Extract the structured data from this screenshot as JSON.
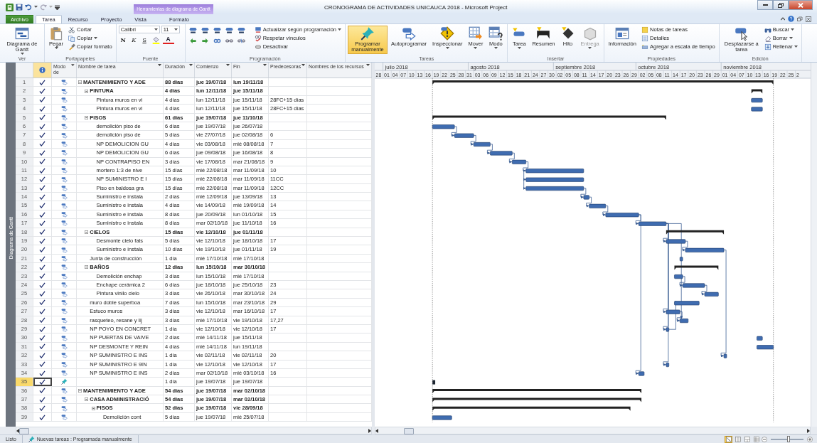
{
  "window": {
    "title": "CRONOGRAMA DE ACTIVIDADES UNICAUCA 2018  -  Microsoft Project",
    "contextual_group": "Herramientas de diagrama de Gantt"
  },
  "tabs": [
    {
      "label": "Archivo",
      "kind": "file",
      "selected": false
    },
    {
      "label": "Tarea",
      "kind": "normal",
      "selected": true
    },
    {
      "label": "Recurso",
      "kind": "normal",
      "selected": false
    },
    {
      "label": "Proyecto",
      "kind": "normal",
      "selected": false
    },
    {
      "label": "Vista",
      "kind": "normal",
      "selected": false
    },
    {
      "label": "Formato",
      "kind": "contextual",
      "selected": false
    }
  ],
  "ribbon": {
    "groups": [
      {
        "label": "Ver",
        "items": [
          {
            "kind": "large",
            "label": "Diagrama de Gantt",
            "menu": true
          }
        ]
      },
      {
        "label": "Portapapeles",
        "items": [
          {
            "kind": "large",
            "label": "Pegar",
            "menu": true
          },
          {
            "kind": "small",
            "label": "Cortar"
          },
          {
            "kind": "small",
            "label": "Copiar",
            "menu": true
          },
          {
            "kind": "small",
            "label": "Copiar formato"
          }
        ]
      },
      {
        "label": "Fuente",
        "items": [
          {
            "kind": "combo",
            "value": "Calibri"
          },
          {
            "kind": "combo",
            "value": "11"
          },
          {
            "kind": "bold",
            "label": "N"
          },
          {
            "kind": "italic",
            "label": "K"
          },
          {
            "kind": "underline",
            "label": "S"
          },
          {
            "kind": "highlight"
          },
          {
            "kind": "font-color",
            "label": "A"
          }
        ]
      },
      {
        "label": "Programación",
        "items": [
          {
            "kind": "tool"
          },
          {
            "kind": "tool"
          },
          {
            "kind": "tool"
          },
          {
            "kind": "tool"
          },
          {
            "kind": "tool"
          },
          {
            "kind": "tool"
          },
          {
            "kind": "tool"
          },
          {
            "kind": "tool"
          },
          {
            "kind": "tool"
          },
          {
            "kind": "tool"
          },
          {
            "kind": "small",
            "label": "Actualizar según programación",
            "menu": true
          },
          {
            "kind": "small",
            "label": "Respetar vínculos"
          },
          {
            "kind": "small",
            "label": "Desactivar"
          }
        ]
      },
      {
        "label": "Tareas",
        "items": [
          {
            "kind": "large",
            "label": "Programar manualmente",
            "on": true
          },
          {
            "kind": "large",
            "label": "Autoprogramar",
            "on": false
          },
          {
            "kind": "large",
            "label": "Inspeccionar",
            "menu": true,
            "on": false
          },
          {
            "kind": "large",
            "label": "Mover",
            "menu": true,
            "on": false
          },
          {
            "kind": "large",
            "label": "Modo",
            "menu": true,
            "on": false
          }
        ]
      },
      {
        "label": "Insertar",
        "items": [
          {
            "kind": "large",
            "label": "Tarea",
            "menu": true,
            "disabled": false
          },
          {
            "kind": "large",
            "label": "Resumen",
            "disabled": false
          },
          {
            "kind": "large",
            "label": "Hito",
            "disabled": false
          },
          {
            "kind": "large",
            "label": "Entrega",
            "menu": true,
            "disabled": true
          }
        ]
      },
      {
        "label": "Propiedades",
        "items": [
          {
            "kind": "large",
            "label": "Información"
          },
          {
            "kind": "small",
            "label": "Notas de tareas"
          },
          {
            "kind": "small",
            "label": "Detalles"
          },
          {
            "kind": "small",
            "label": "Agregar a escala de tiempo"
          }
        ]
      },
      {
        "label": "Edición",
        "items": [
          {
            "kind": "large",
            "label": "Desplazarse a tarea"
          },
          {
            "kind": "small",
            "label": "Buscar",
            "menu": true
          },
          {
            "kind": "small",
            "label": "Borrar",
            "menu": true
          },
          {
            "kind": "small",
            "label": "Rellenar",
            "menu": true
          }
        ]
      }
    ]
  },
  "view_bar": {
    "label": "Diagrama de Gantt"
  },
  "table": {
    "columns": [
      {
        "label": "Modo de"
      },
      {
        "label": "Nombre de tarea"
      },
      {
        "label": "Duración"
      },
      {
        "label": "Comienzo"
      },
      {
        "label": "Fin"
      },
      {
        "label": "Predecesoras"
      },
      {
        "label": "Nombres de los recursos"
      }
    ]
  },
  "tasks": [
    {
      "id": "1",
      "done": true,
      "kind": "auto",
      "summary": true,
      "expanded": true,
      "selected": false,
      "name": "MANTENIMIENTO Y ADE",
      "duration": "88 días",
      "start": "jue 19/07/18",
      "finish": "lun 19/11/18",
      "children": [
        {
          "id": "2",
          "done": true,
          "kind": "auto",
          "summary": true,
          "expanded": true,
          "selected": false,
          "name": "PINTURA",
          "duration": "4 días",
          "start": "lun 12/11/18",
          "finish": "jue 15/11/18",
          "children": [
            {
              "id": "3",
              "done": true,
              "kind": "auto",
              "summary": false,
              "selected": false,
              "name": "Pintura muros en vi",
              "duration": "4 días",
              "start": "lun 12/11/18",
              "finish": "jue 15/11/18",
              "predecessors": "28FC+15 días"
            },
            {
              "id": "4",
              "done": true,
              "kind": "auto",
              "summary": false,
              "selected": false,
              "name": "Pintura muros en vi",
              "duration": "4 días",
              "start": "lun 12/11/18",
              "finish": "jue 15/11/18",
              "predecessors": "28FC+15 días"
            }
          ]
        },
        {
          "id": "5",
          "done": true,
          "kind": "auto",
          "summary": true,
          "expanded": true,
          "selected": false,
          "name": "PISOS",
          "duration": "61 días",
          "start": "jue 19/07/18",
          "finish": "jue 11/10/18",
          "children": [
            {
              "id": "6",
              "done": true,
              "kind": "auto",
              "summary": false,
              "selected": false,
              "name": "demolición piso de",
              "duration": "6 días",
              "start": "jue 19/07/18",
              "finish": "jue 26/07/18"
            },
            {
              "id": "7",
              "done": true,
              "kind": "auto",
              "summary": false,
              "selected": false,
              "name": "demolición piso de",
              "duration": "5 días",
              "start": "vie 27/07/18",
              "finish": "jue 02/08/18",
              "predecessors": "6"
            },
            {
              "id": "8",
              "done": true,
              "kind": "auto",
              "summary": false,
              "selected": false,
              "name": "NP DEMOLICION GU",
              "duration": "4 días",
              "start": "vie 03/08/18",
              "finish": "mié 08/08/18",
              "predecessors": "7"
            },
            {
              "id": "9",
              "done": true,
              "kind": "auto",
              "summary": false,
              "selected": false,
              "name": "NP DEMOLICION GU",
              "duration": "6 días",
              "start": "jue 09/08/18",
              "finish": "jue 16/08/18",
              "predecessors": "8"
            },
            {
              "id": "10",
              "done": true,
              "kind": "auto",
              "summary": false,
              "selected": false,
              "name": "NP CONTRAPISO EN",
              "duration": "3 días",
              "start": "vie 17/08/18",
              "finish": "mar 21/08/18",
              "predecessors": "9"
            },
            {
              "id": "11",
              "done": true,
              "kind": "auto",
              "summary": false,
              "selected": false,
              "name": "mortero 1:3 de nive",
              "duration": "15 días",
              "start": "mié 22/08/18",
              "finish": "mar 11/09/18",
              "predecessors": "10"
            },
            {
              "id": "12",
              "done": true,
              "kind": "auto",
              "summary": false,
              "selected": false,
              "name": "NP SUMINISTRO E I",
              "duration": "15 días",
              "start": "mié 22/08/18",
              "finish": "mar 11/09/18",
              "predecessors": "11CC"
            },
            {
              "id": "13",
              "done": true,
              "kind": "auto",
              "summary": false,
              "selected": false,
              "name": "Piso en baldosa gra",
              "duration": "15 días",
              "start": "mié 22/08/18",
              "finish": "mar 11/09/18",
              "predecessors": "12CC"
            },
            {
              "id": "14",
              "done": true,
              "kind": "auto",
              "summary": false,
              "selected": false,
              "name": "Suministro e instala",
              "duration": "2 días",
              "start": "mié 12/09/18",
              "finish": "jue 13/09/18",
              "predecessors": "13"
            },
            {
              "id": "15",
              "done": true,
              "kind": "auto",
              "summary": false,
              "selected": false,
              "name": "Suministro e instala",
              "duration": "4 días",
              "start": "vie 14/09/18",
              "finish": "mié 19/09/18",
              "predecessors": "14"
            },
            {
              "id": "16",
              "done": true,
              "kind": "auto",
              "summary": false,
              "selected": false,
              "name": "Suministro e instala",
              "duration": "8 días",
              "start": "jue 20/09/18",
              "finish": "lun 01/10/18",
              "predecessors": "15"
            },
            {
              "id": "17",
              "done": true,
              "kind": "auto",
              "summary": false,
              "selected": false,
              "name": "Suministro e instala",
              "duration": "8 días",
              "start": "mar 02/10/18",
              "finish": "jue 11/10/18",
              "predecessors": "16"
            }
          ]
        },
        {
          "id": "18",
          "done": true,
          "kind": "auto",
          "summary": true,
          "expanded": true,
          "selected": false,
          "name": "CIELOS",
          "duration": "15 días",
          "start": "vie 12/10/18",
          "finish": "jue 01/11/18",
          "children": [
            {
              "id": "19",
              "done": true,
              "kind": "auto",
              "summary": false,
              "selected": false,
              "name": "Desmonte cielo fals",
              "duration": "5 días",
              "start": "vie 12/10/18",
              "finish": "jue 18/10/18",
              "predecessors": "17"
            },
            {
              "id": "20",
              "done": true,
              "kind": "auto",
              "summary": false,
              "selected": false,
              "name": "Suministro e instala",
              "duration": "10 días",
              "start": "vie 19/10/18",
              "finish": "jue 01/11/18",
              "predecessors": "19"
            }
          ]
        },
        {
          "id": "21",
          "done": true,
          "kind": "auto",
          "summary": false,
          "selected": false,
          "name": "Junta de construcción",
          "duration": "1 día",
          "start": "mié 17/10/18",
          "finish": "mié 17/10/18"
        },
        {
          "id": "22",
          "done": true,
          "kind": "auto",
          "summary": true,
          "expanded": true,
          "selected": false,
          "name": "BAÑOS",
          "duration": "12 días",
          "start": "lun 15/10/18",
          "finish": "mar 30/10/18",
          "children": [
            {
              "id": "23",
              "done": true,
              "kind": "auto",
              "summary": false,
              "selected": false,
              "name": "Demolición enchap",
              "duration": "3 días",
              "start": "lun 15/10/18",
              "finish": "mié 17/10/18"
            },
            {
              "id": "24",
              "done": true,
              "kind": "auto",
              "summary": false,
              "selected": false,
              "name": "Enchape cerámica 2",
              "duration": "6 días",
              "start": "jue 18/10/18",
              "finish": "jue 25/10/18",
              "predecessors": "23"
            },
            {
              "id": "25",
              "done": true,
              "kind": "auto",
              "summary": false,
              "selected": false,
              "name": "Pintura vinilo cielo",
              "duration": "3 días",
              "start": "vie 26/10/18",
              "finish": "mar 30/10/18",
              "predecessors": "24"
            }
          ]
        },
        {
          "id": "26",
          "done": true,
          "kind": "auto",
          "summary": false,
          "selected": false,
          "name": "muro doble superboa",
          "duration": "7 días",
          "start": "lun 15/10/18",
          "finish": "mar 23/10/18",
          "predecessors": "29"
        },
        {
          "id": "27",
          "done": true,
          "kind": "auto",
          "summary": false,
          "selected": false,
          "name": "Estuco muros",
          "duration": "3 días",
          "start": "vie 12/10/18",
          "finish": "mar 16/10/18",
          "predecessors": "17"
        },
        {
          "id": "28",
          "done": true,
          "kind": "auto",
          "summary": false,
          "selected": false,
          "name": "rasqueteo, resane y lij",
          "duration": "3 días",
          "start": "mié 17/10/18",
          "finish": "vie 19/10/18",
          "predecessors": "17,27"
        },
        {
          "id": "29",
          "done": true,
          "kind": "auto",
          "summary": false,
          "selected": false,
          "name": "NP POYO EN CONCRET",
          "duration": "1 día",
          "start": "vie 12/10/18",
          "finish": "vie 12/10/18",
          "predecessors": "17"
        },
        {
          "id": "30",
          "done": true,
          "kind": "auto",
          "summary": false,
          "selected": false,
          "name": "NP PUERTAS DE VAIVE",
          "duration": "2 días",
          "start": "mié 14/11/18",
          "finish": "jue 15/11/18"
        },
        {
          "id": "31",
          "done": true,
          "kind": "auto",
          "summary": false,
          "selected": false,
          "name": "NP DESMONTE Y REIN",
          "duration": "4 días",
          "start": "mié 14/11/18",
          "finish": "lun 19/11/18"
        },
        {
          "id": "32",
          "done": true,
          "kind": "auto",
          "summary": false,
          "selected": false,
          "name": "NP SUMINISTRO E INS",
          "duration": "1 día",
          "start": "vie 02/11/18",
          "finish": "vie 02/11/18",
          "predecessors": "20"
        },
        {
          "id": "33",
          "done": true,
          "kind": "auto",
          "summary": false,
          "selected": false,
          "name": "NP SUMINISTRO E 9IN",
          "duration": "1 día",
          "start": "vie 12/10/18",
          "finish": "vie 12/10/18",
          "predecessors": "17"
        },
        {
          "id": "34",
          "done": true,
          "kind": "auto",
          "summary": false,
          "selected": false,
          "name": "NP SUMINISTRO E INS",
          "duration": "2 días",
          "start": "mar 02/10/18",
          "finish": "mié 03/10/18",
          "predecessors": "16"
        }
      ]
    },
    {
      "id": "35",
      "done": true,
      "kind": "manual",
      "summary": false,
      "selected": true,
      "duration": "1 día",
      "start": "jue 19/07/18",
      "finish": "jue 19/07/18"
    },
    {
      "id": "36",
      "done": true,
      "kind": "auto",
      "summary": true,
      "expanded": true,
      "selected": false,
      "name": "MANTENIMIENTO Y ADE",
      "duration": "54 días",
      "start": "jue 19/07/18",
      "finish": "mar 02/10/18",
      "children": [
        {
          "id": "37",
          "done": true,
          "kind": "auto",
          "summary": true,
          "expanded": true,
          "selected": false,
          "name": "CASA ADMINISTRACIÓ",
          "duration": "54 días",
          "start": "jue 19/07/18",
          "finish": "mar 02/10/18",
          "children": [
            {
              "id": "38",
              "done": true,
              "kind": "auto",
              "summary": true,
              "expanded": true,
              "selected": false,
              "name": "PISOS",
              "duration": "52 días",
              "start": "jue 19/07/18",
              "finish": "vie 28/09/18",
              "children": [
                {
                  "id": "39",
                  "done": true,
                  "kind": "auto",
                  "summary": false,
                  "selected": false,
                  "name": "Demolición cont",
                  "duration": "5 días",
                  "start": "jue 19/07/18",
                  "finish": "mié 25/07/18"
                }
              ]
            }
          ]
        }
      ]
    }
  ],
  "timescale": {
    "months": [
      "julio 2018",
      "agosto 2018",
      "septiembre 2018",
      "octubre 2018",
      "noviembre 2018"
    ],
    "days": [
      "28",
      "01",
      "04",
      "07",
      "10",
      "13",
      "16",
      "19",
      "22",
      "25",
      "28",
      "31",
      "03",
      "06",
      "09",
      "12",
      "15",
      "18",
      "21",
      "24",
      "27",
      "30",
      "02",
      "05",
      "08",
      "11",
      "14",
      "17",
      "20",
      "23",
      "26",
      "29",
      "02",
      "05",
      "08",
      "11",
      "14",
      "17",
      "20",
      "23",
      "26",
      "29",
      "01",
      "04",
      "07",
      "10",
      "13",
      "16",
      "19",
      "22",
      "25",
      "2"
    ]
  },
  "status_bar": {
    "ready": "Listo",
    "new_tasks": "Nuevas tareas : Programada manualmente",
    "views": [
      {
        "selected": true
      },
      {
        "selected": false
      },
      {
        "selected": false
      },
      {
        "selected": false
      }
    ],
    "zoom": {
      "level": 0.55
    }
  }
}
